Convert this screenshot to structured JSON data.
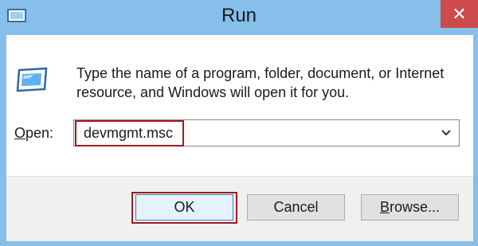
{
  "window": {
    "title": "Run",
    "close_icon": "close-icon",
    "title_icon": "run-icon"
  },
  "dialog": {
    "description": "Type the name of a program, folder, document, or Internet resource, and Windows will open it for you.",
    "open_label_prefix": "",
    "open_label_accel": "O",
    "open_label_rest": "pen:",
    "open_value": "devmgmt.msc",
    "dropdown_icon": "chevron-down-icon"
  },
  "buttons": {
    "ok": "OK",
    "cancel": "Cancel",
    "browse_accel": "B",
    "browse_rest": "rowse..."
  },
  "colors": {
    "titlebar": "#86bfe9",
    "close": "#cc4a4a",
    "highlight": "#a11a22"
  }
}
